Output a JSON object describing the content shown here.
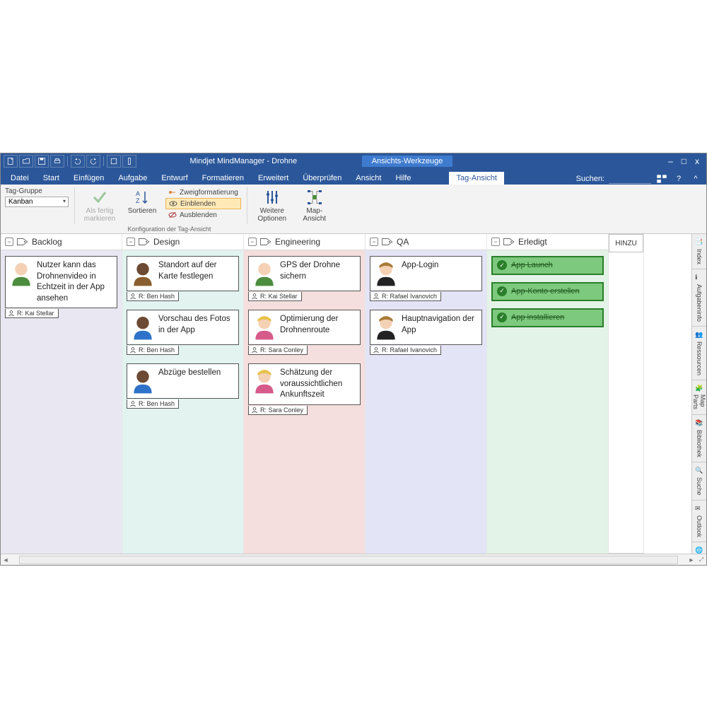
{
  "title": "Mindjet MindManager - Drohne",
  "context_tab_title": "Ansichts-Werkzeuge",
  "window_controls": {
    "min": "‒",
    "max": "□",
    "close": "x"
  },
  "tabs": [
    "Datei",
    "Start",
    "Einfügen",
    "Aufgabe",
    "Entwurf",
    "Formatieren",
    "Erweitert",
    "Überprüfen",
    "Ansicht",
    "Hilfe"
  ],
  "context_tab": "Tag-Ansicht",
  "search_label": "Suchen:",
  "ribbon": {
    "tag_group_label": "Tag-Gruppe",
    "tag_group_value": "Kanban",
    "als_fertig": "Als fertig\nmarkieren",
    "sortieren": "Sortieren",
    "zweig": "Zweigformatierung",
    "einblenden": "Einblenden",
    "ausblenden": "Ausblenden",
    "weitere": "Weitere\nOptionen",
    "map_ansicht": "Map-Ansicht",
    "group_caption": "Konfiguration der Tag-Ansicht"
  },
  "columns": [
    {
      "name": "Backlog",
      "bg": "#e9e8f2",
      "cards": [
        {
          "text": "Nutzer kann das Drohnenvideo in Echtzeit in der App ansehen",
          "avatar": {
            "skin": "#f4d1b5",
            "shirt": "#4c8c3d"
          },
          "assignee": "R: Kai Stellar"
        }
      ]
    },
    {
      "name": "Design",
      "bg": "#e2f3f0",
      "cards": [
        {
          "text": "Standort auf der Karte festlegen",
          "avatar": {
            "skin": "#6c4a33",
            "shirt": "#8a5f2f"
          },
          "assignee": "R: Ben Hash"
        },
        {
          "text": "Vorschau des Fotos in der App",
          "avatar": {
            "skin": "#6c4a33",
            "shirt": "#2e73c9"
          },
          "assignee": "R: Ben Hash"
        },
        {
          "text": "Abzüge bestellen",
          "avatar": {
            "skin": "#6c4a33",
            "shirt": "#2e73c9"
          },
          "assignee": "R: Ben Hash"
        }
      ]
    },
    {
      "name": "Engineering",
      "bg": "#f5dede",
      "cards": [
        {
          "text": "GPS der Drohne sichern",
          "avatar": {
            "skin": "#f4d1b5",
            "shirt": "#4c8c3d"
          },
          "assignee": "R: Kai Stellar"
        },
        {
          "text": "Optimierung der Drohnenroute",
          "avatar": {
            "skin": "#f4d1b5",
            "shirt": "#d65a8a",
            "hair": "#e6c24a"
          },
          "assignee": "R: Sara Conley"
        },
        {
          "text": "Schätzung der voraussichtlichen Ankunftszeit",
          "avatar": {
            "skin": "#f4d1b5",
            "shirt": "#d65a8a",
            "hair": "#e6c24a"
          },
          "assignee": "R: Sara Conley"
        }
      ]
    },
    {
      "name": "QA",
      "bg": "#e4e4f7",
      "cards": [
        {
          "text": "App-Login",
          "avatar": {
            "skin": "#f4d1b5",
            "shirt": "#222",
            "hair": "#a87a3a"
          },
          "assignee": "R: Rafael Ivanovich"
        },
        {
          "text": "Hauptnavigation der App",
          "avatar": {
            "skin": "#f4d1b5",
            "shirt": "#222",
            "hair": "#a87a3a"
          },
          "assignee": "R: Rafael Ivanovich"
        }
      ]
    },
    {
      "name": "Erledigt",
      "bg": "#e4f3e7",
      "done_cards": [
        "App Launch",
        "App-Konto erstellen",
        "App installieren"
      ]
    }
  ],
  "add_col": "HINZU",
  "sidetabs": [
    "Index",
    "Aufgabeninfo",
    "Ressourcen",
    "Map Parts",
    "Bibliothek",
    "Suche",
    "Outlook",
    "Browser"
  ]
}
